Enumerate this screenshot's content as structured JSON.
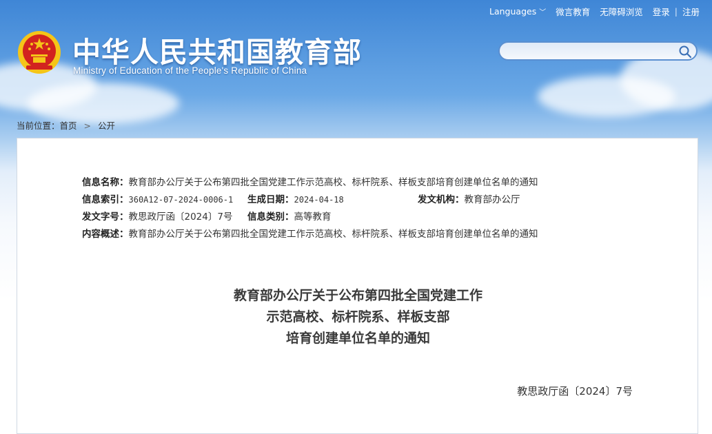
{
  "topnav": {
    "languages": "Languages",
    "weiyan": "微言教育",
    "accessibility": "无障碍浏览",
    "login": "登录",
    "separator": "|",
    "register": "注册"
  },
  "header": {
    "title": "中华人民共和国教育部",
    "subtitle": "Ministry of Education of the People's Republic of China"
  },
  "search": {
    "placeholder": "",
    "value": ""
  },
  "breadcrumb": {
    "prefix": "当前位置：",
    "home": "首页",
    "current": "公开"
  },
  "meta": {
    "name_label": "信息名称：",
    "name_value": "教育部办公厅关于公布第四批全国党建工作示范高校、标杆院系、样板支部培育创建单位名单的通知",
    "index_label": "信息索引：",
    "index_value": "360A12-07-2024-0006-1",
    "date_label": "生成日期：",
    "date_value": "2024-04-18",
    "org_label": "发文机构：",
    "org_value": "教育部办公厅",
    "docno_label": "发文字号：",
    "docno_value": "教思政厅函〔2024〕7号",
    "category_label": "信息类别：",
    "category_value": "高等教育",
    "summary_label": "内容概述：",
    "summary_value": "教育部办公厅关于公布第四批全国党建工作示范高校、标杆院系、样板支部培育创建单位名单的通知"
  },
  "document": {
    "title_lines": [
      "教育部办公厅关于公布第四批全国党建工作",
      "示范高校、标杆院系、样板支部",
      "培育创建单位名单的通知"
    ],
    "number": "教思政厅函〔2024〕7号"
  },
  "colors": {
    "header_blue": "#3f86d6",
    "emblem_red": "#d2231f",
    "emblem_gold": "#f5c518",
    "panel_border": "#cfd8e3"
  },
  "icons": [
    "national-emblem-icon",
    "chevron-down-icon",
    "search-icon"
  ]
}
